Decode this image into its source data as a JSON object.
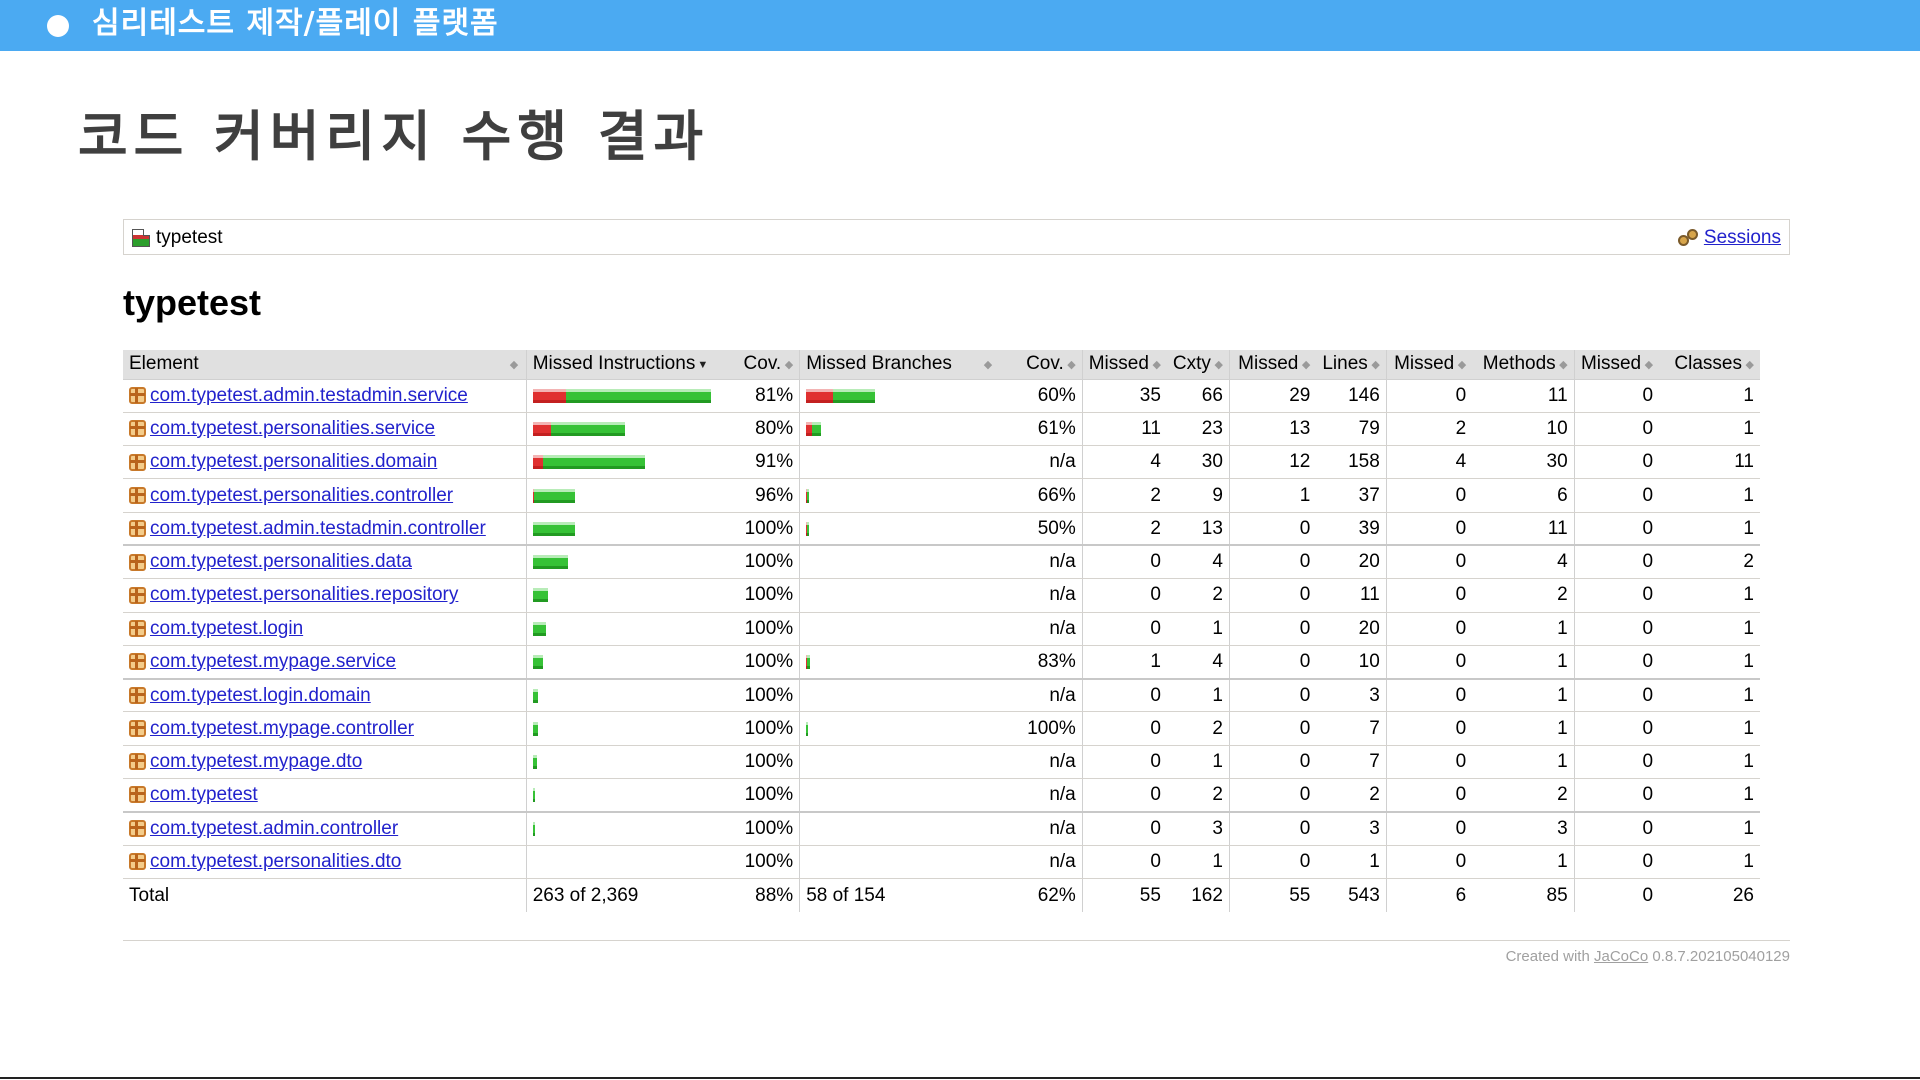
{
  "header": {
    "title": "심리테스트 제작/플레이 플랫폼",
    "accent_color": "#4baaf2"
  },
  "slide_title": "코드 커버리지 수행 결과",
  "breadcrumb": {
    "report_name": "typetest",
    "report_icon": "report-icon",
    "sessions_label": "Sessions",
    "sessions_icon": "sessions-icon"
  },
  "report_title": "typetest",
  "table": {
    "columns": [
      "Element",
      "Missed Instructions",
      "Cov.",
      "Missed Branches",
      "Cov.",
      "Missed",
      "Cxty",
      "Missed",
      "Lines",
      "Missed",
      "Methods",
      "Missed",
      "Classes"
    ],
    "rows": [
      {
        "name": "com.typetest.admin.testadmin.service",
        "instr": {
          "missed": 47,
          "covered": 208
        },
        "inst_cov": "81%",
        "branch": {
          "missed": 38,
          "covered": 61
        },
        "br_cov": "60%",
        "missed_cxty": "35",
        "cxty": "66",
        "missed_lines": "29",
        "lines": "146",
        "missed_methods": "0",
        "methods": "11",
        "missed_classes": "0",
        "classes": "1"
      },
      {
        "name": "com.typetest.personalities.service",
        "instr": {
          "missed": 26,
          "covered": 106
        },
        "inst_cov": "80%",
        "branch": {
          "missed": 8,
          "covered": 13
        },
        "br_cov": "61%",
        "missed_cxty": "11",
        "cxty": "23",
        "missed_lines": "13",
        "lines": "79",
        "missed_methods": "2",
        "methods": "10",
        "missed_classes": "0",
        "classes": "1"
      },
      {
        "name": "com.typetest.personalities.domain",
        "instr": {
          "missed": 14,
          "covered": 147
        },
        "inst_cov": "91%",
        "branch": null,
        "br_cov": "n/a",
        "missed_cxty": "4",
        "cxty": "30",
        "missed_lines": "12",
        "lines": "158",
        "missed_methods": "4",
        "methods": "30",
        "missed_classes": "0",
        "classes": "11"
      },
      {
        "name": "com.typetest.personalities.controller",
        "instr": {
          "missed": 2,
          "covered": 58
        },
        "inst_cov": "96%",
        "branch": {
          "missed": 1,
          "covered": 2
        },
        "br_cov": "66%",
        "missed_cxty": "2",
        "cxty": "9",
        "missed_lines": "1",
        "lines": "37",
        "missed_methods": "0",
        "methods": "6",
        "missed_classes": "0",
        "classes": "1"
      },
      {
        "name": "com.typetest.admin.testadmin.controller",
        "instr": {
          "missed": 0,
          "covered": 60
        },
        "inst_cov": "100%",
        "branch": {
          "missed": 1,
          "covered": 1
        },
        "br_cov": "50%",
        "missed_cxty": "2",
        "cxty": "13",
        "missed_lines": "0",
        "lines": "39",
        "missed_methods": "0",
        "methods": "11",
        "missed_classes": "0",
        "classes": "1"
      },
      {
        "name": "com.typetest.personalities.data",
        "instr": {
          "missed": 0,
          "covered": 50
        },
        "inst_cov": "100%",
        "branch": null,
        "br_cov": "n/a",
        "missed_cxty": "0",
        "cxty": "4",
        "missed_lines": "0",
        "lines": "20",
        "missed_methods": "0",
        "methods": "4",
        "missed_classes": "0",
        "classes": "2"
      },
      {
        "name": "com.typetest.personalities.repository",
        "instr": {
          "missed": 0,
          "covered": 22
        },
        "inst_cov": "100%",
        "branch": null,
        "br_cov": "n/a",
        "missed_cxty": "0",
        "cxty": "2",
        "missed_lines": "0",
        "lines": "11",
        "missed_methods": "0",
        "methods": "2",
        "missed_classes": "0",
        "classes": "1"
      },
      {
        "name": "com.typetest.login",
        "instr": {
          "missed": 0,
          "covered": 19
        },
        "inst_cov": "100%",
        "branch": null,
        "br_cov": "n/a",
        "missed_cxty": "0",
        "cxty": "1",
        "missed_lines": "0",
        "lines": "20",
        "missed_methods": "0",
        "methods": "1",
        "missed_classes": "0",
        "classes": "1"
      },
      {
        "name": "com.typetest.mypage.service",
        "instr": {
          "missed": 0,
          "covered": 15
        },
        "inst_cov": "100%",
        "branch": {
          "missed": 1,
          "covered": 5
        },
        "br_cov": "83%",
        "missed_cxty": "1",
        "cxty": "4",
        "missed_lines": "0",
        "lines": "10",
        "missed_methods": "0",
        "methods": "1",
        "missed_classes": "0",
        "classes": "1"
      },
      {
        "name": "com.typetest.login.domain",
        "instr": {
          "missed": 0,
          "covered": 8
        },
        "inst_cov": "100%",
        "branch": null,
        "br_cov": "n/a",
        "missed_cxty": "0",
        "cxty": "1",
        "missed_lines": "0",
        "lines": "3",
        "missed_methods": "0",
        "methods": "1",
        "missed_classes": "0",
        "classes": "1"
      },
      {
        "name": "com.typetest.mypage.controller",
        "instr": {
          "missed": 0,
          "covered": 8
        },
        "inst_cov": "100%",
        "branch": {
          "missed": 0,
          "covered": 2
        },
        "br_cov": "100%",
        "missed_cxty": "0",
        "cxty": "2",
        "missed_lines": "0",
        "lines": "7",
        "missed_methods": "0",
        "methods": "1",
        "missed_classes": "0",
        "classes": "1"
      },
      {
        "name": "com.typetest.mypage.dto",
        "instr": {
          "missed": 0,
          "covered": 6
        },
        "inst_cov": "100%",
        "branch": null,
        "br_cov": "n/a",
        "missed_cxty": "0",
        "cxty": "1",
        "missed_lines": "0",
        "lines": "7",
        "missed_methods": "0",
        "methods": "1",
        "missed_classes": "0",
        "classes": "1"
      },
      {
        "name": "com.typetest",
        "instr": {
          "missed": 0,
          "covered": 2
        },
        "inst_cov": "100%",
        "branch": null,
        "br_cov": "n/a",
        "missed_cxty": "0",
        "cxty": "2",
        "missed_lines": "0",
        "lines": "2",
        "missed_methods": "0",
        "methods": "2",
        "missed_classes": "0",
        "classes": "1"
      },
      {
        "name": "com.typetest.admin.controller",
        "instr": {
          "missed": 0,
          "covered": 2
        },
        "inst_cov": "100%",
        "branch": null,
        "br_cov": "n/a",
        "missed_cxty": "0",
        "cxty": "3",
        "missed_lines": "0",
        "lines": "3",
        "missed_methods": "0",
        "methods": "3",
        "missed_classes": "0",
        "classes": "1"
      },
      {
        "name": "com.typetest.personalities.dto",
        "instr": null,
        "inst_cov": "100%",
        "branch": null,
        "br_cov": "n/a",
        "missed_cxty": "0",
        "cxty": "1",
        "missed_lines": "0",
        "lines": "1",
        "missed_methods": "0",
        "methods": "1",
        "missed_classes": "0",
        "classes": "1"
      }
    ],
    "total": {
      "label": "Total",
      "instructions": "263 of 2,369",
      "inst_cov": "88%",
      "branches": "58 of 154",
      "br_cov": "62%",
      "missed_cxty": "55",
      "cxty": "162",
      "missed_lines": "55",
      "lines": "543",
      "missed_methods": "6",
      "methods": "85",
      "missed_classes": "0",
      "classes": "26"
    }
  },
  "footer": {
    "prefix": "Created with",
    "link": "JaCoCo",
    "version": "0.8.7.202105040129"
  }
}
